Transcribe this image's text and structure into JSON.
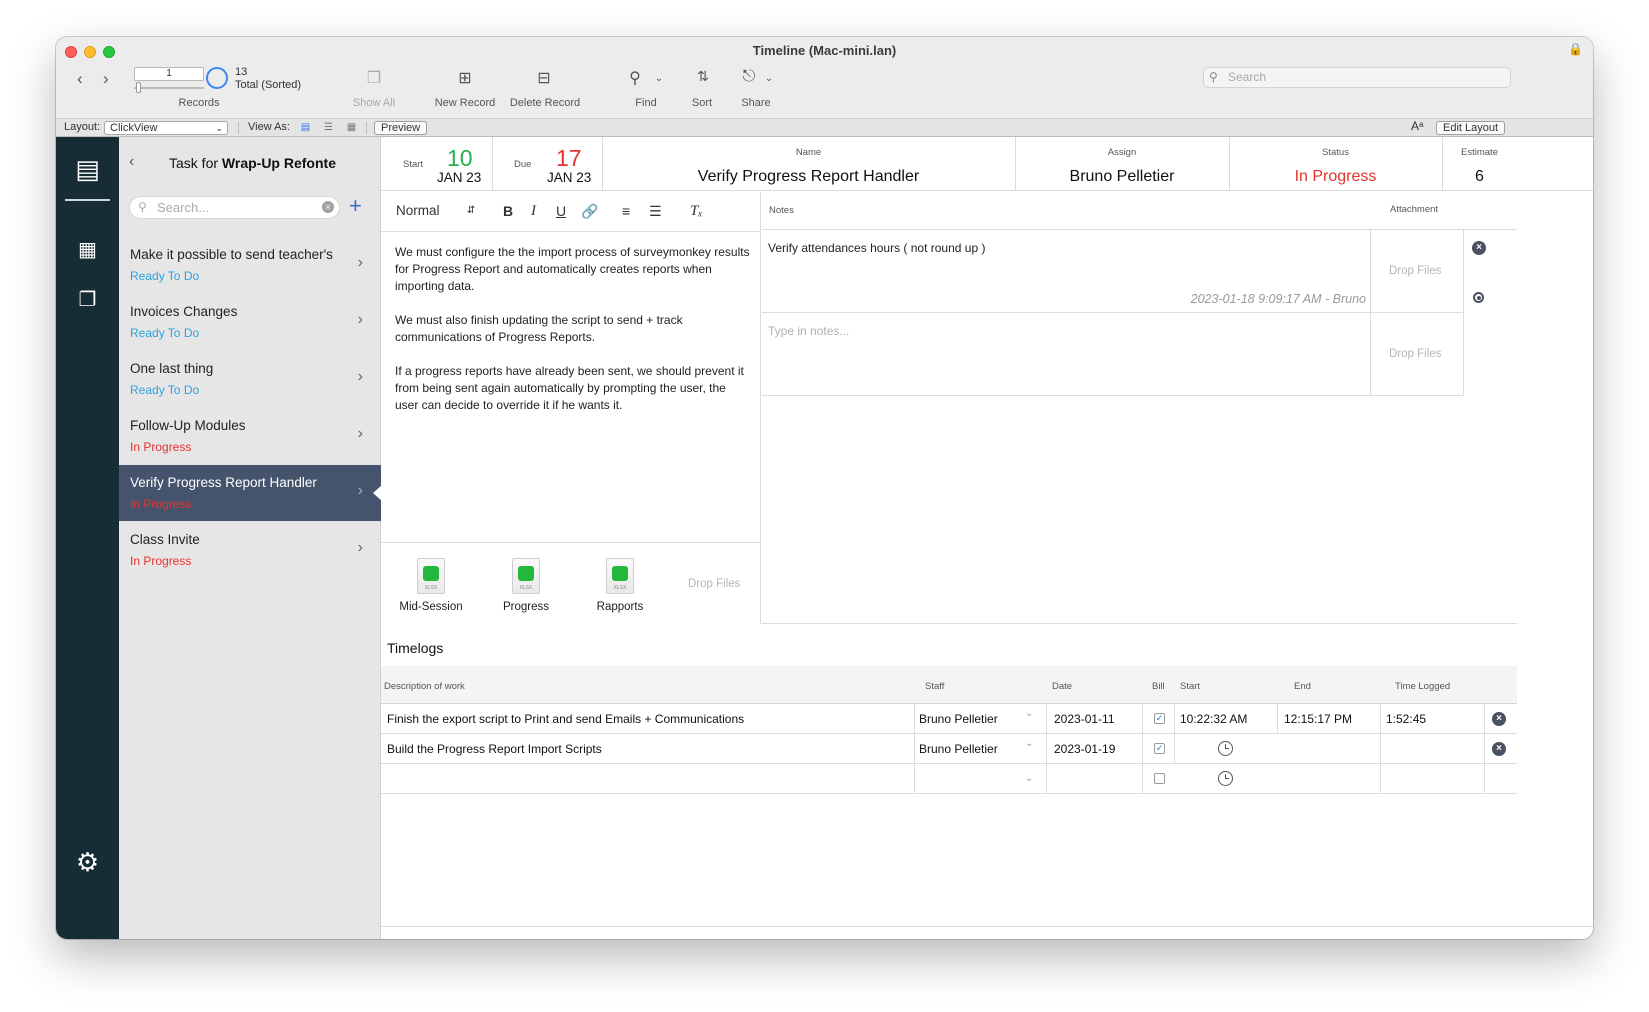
{
  "window": {
    "title": "Timeline (Mac-mini.lan)"
  },
  "toolbar": {
    "record_number": "1",
    "record_count": "13",
    "record_sorted": "Total (Sorted)",
    "records_label": "Records",
    "show_all_label": "Show All",
    "new_record_label": "New Record",
    "delete_record_label": "Delete Record",
    "find_label": "Find",
    "sort_label": "Sort",
    "share_label": "Share",
    "search_placeholder": "Search"
  },
  "layoutbar": {
    "layout_label": "Layout:",
    "layout_value": "ClickView",
    "view_as_label": "View As:",
    "preview_label": "Preview",
    "edit_layout_label": "Edit Layout",
    "font_size_glyph": "Aᵃ"
  },
  "sidebar": {
    "title_prefix": "Task for",
    "title_project": "Wrap-Up Refonte",
    "search_placeholder": "Search...",
    "items": [
      {
        "name": "Make it possible to send teacher's",
        "status": "Ready To Do"
      },
      {
        "name": "Invoices Changes",
        "status": "Ready To Do"
      },
      {
        "name": "One last thing",
        "status": "Ready To Do"
      },
      {
        "name": "Follow-Up Modules",
        "status": "In Progress"
      },
      {
        "name": "Verify Progress Report Handler",
        "status": "In Progress"
      },
      {
        "name": "Class Invite",
        "status": "In Progress"
      }
    ]
  },
  "task": {
    "start_label": "Start",
    "start_day": "10",
    "start_month": "JAN 23",
    "due_label": "Due",
    "due_day": "17",
    "due_month": "JAN 23",
    "name_label": "Name",
    "name": "Verify Progress Report Handler",
    "assign_label": "Assign",
    "assign": "Bruno Pelletier",
    "status_label": "Status",
    "status": "In Progress",
    "estimate_label": "Estimate",
    "estimate": "6"
  },
  "editor": {
    "style_select": "Normal",
    "paragraphs": [
      "We must configure the the import process of surveymonkey results for Progress Report and automatically creates reports when importing data.",
      "We must also finish updating the script to send + track communications of Progress Reports.",
      "If a progress reports have already been sent, we should prevent it from being sent again automatically by prompting the user, the user can decide to override it if he wants it."
    ],
    "files": [
      {
        "name": "Mid-Session",
        "type": "XLSX"
      },
      {
        "name": "Progress",
        "type": "XLSX"
      },
      {
        "name": "Rapports",
        "type": "XLSX"
      }
    ],
    "drop_files": "Drop Files"
  },
  "notes": {
    "notes_label": "Notes",
    "attachment_label": "Attachment",
    "entries": [
      {
        "text": "Verify attendances hours ( not round up )",
        "meta": "2023-01-18 9:09:17 AM - Bruno",
        "drop": "Drop Files"
      }
    ],
    "new_placeholder": "Type in notes...",
    "new_drop": "Drop Files"
  },
  "timelogs": {
    "title": "Timelogs",
    "columns": [
      "Description of work",
      "Staff",
      "Date",
      "Bill",
      "Start",
      "End",
      "Time Logged"
    ],
    "rows": [
      {
        "description": "Finish the export script to Print and send Emails + Communications",
        "staff": "Bruno Pelletier",
        "date": "2023-01-11",
        "bill": "✓",
        "start": "10:22:32 AM",
        "end": "12:15:17 PM",
        "logged": "1:52:45"
      },
      {
        "description": "Build the Progress Report Import Scripts",
        "staff": "Bruno Pelletier",
        "date": "2023-01-19",
        "bill": "✓",
        "start": "",
        "end": "",
        "logged": ""
      },
      {
        "description": "",
        "staff": "",
        "date": "",
        "bill": "",
        "start": "",
        "end": "",
        "logged": ""
      }
    ]
  },
  "colors": {
    "rail": "#162d35",
    "selected_item": "#45546c",
    "ready": "#2aa2e0",
    "in_progress": "#e3342f",
    "start_day": "#22b14c",
    "due_day": "#e3342f"
  }
}
